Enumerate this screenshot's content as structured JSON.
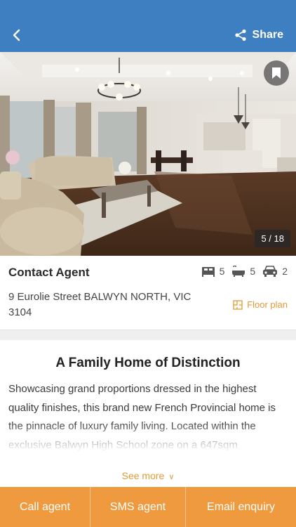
{
  "header": {
    "share_label": "Share"
  },
  "photo": {
    "counter": "5 / 18"
  },
  "listing": {
    "title": "Contact Agent",
    "bedrooms": "5",
    "bathrooms": "5",
    "car_spaces": "2",
    "address": "9 Eurolie Street BALWYN NORTH, VIC 3104",
    "floor_plan_label": "Floor plan"
  },
  "description": {
    "title": "A Family Home of Distinction",
    "body": "Showcasing grand proportions dressed in the highest quality finishes, this brand new French Provincial home is the pinnacle of luxury family living. Located within the exclusive Balwyn High School zone on a 647sqm",
    "see_more_label": "See more"
  },
  "actions": {
    "call": "Call agent",
    "sms": "SMS agent",
    "email": "Email enquiry"
  },
  "colors": {
    "header": "#3d7fc1",
    "accent": "#ef9a3f",
    "link": "#e49a35"
  }
}
